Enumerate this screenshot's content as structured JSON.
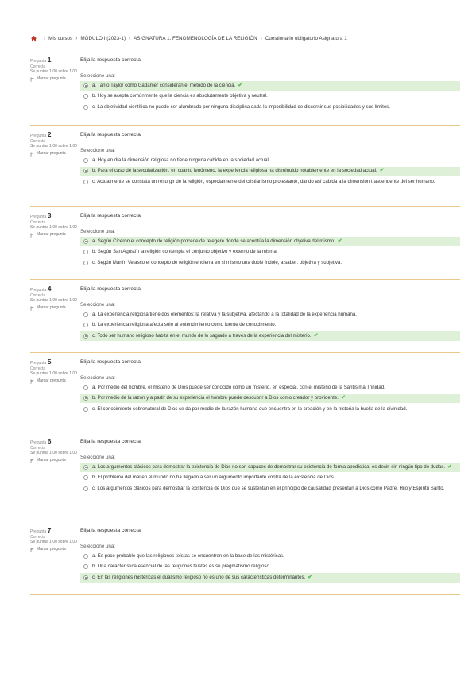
{
  "breadcrumb": [
    "Mis cursos",
    "MÓDULO I (2023-1)",
    "ASIGNATURA 1. FENOMENOLOGÍA DE LA RELIGIÓN",
    "Cuestionario obligatorio Asignatura 1"
  ],
  "labels": {
    "question": "Pregunta",
    "flag": "Marcar pregunta",
    "prompt": "Seleccione una:"
  },
  "questions": [
    {
      "number": "1",
      "state": "Correcta",
      "grade": "Se puntúa 1,00 sobre 1,00",
      "text": "Elija la respuesta correcta",
      "options": [
        {
          "text": "a. Tanto Taylor como Gadamer consideran el método de la ciencia.",
          "correct": true
        },
        {
          "text": "b. Hoy se acepta comúnmente que la ciencia es absolutamente objetiva y neutral.",
          "correct": false
        },
        {
          "text": "c. La objetividad científica no puede ser alumbrado por ninguna disciplina dada la imposibilidad de discernir sus posibilidades y sus límites.",
          "correct": false
        }
      ]
    },
    {
      "number": "2",
      "state": "Correcta",
      "grade": "Se puntúa 1,00 sobre 1,00",
      "text": "Elija la respuesta correcta",
      "options": [
        {
          "text": "a. Hoy en día la dimensión religiosa no tiene ninguna cabida en la sociedad actual.",
          "correct": false
        },
        {
          "text": "b. Para el caso de la secularización, en cuanto fenómeno, la experiencia religiosa ha disminuido notablemente en la sociedad actual.",
          "correct": true
        },
        {
          "text": "c. Actualmente se constata un resurgir de la religión, especialmente del cristianismo protestante, dando así cabida a la dimensión trascendente del ser humano.",
          "correct": false
        }
      ]
    },
    {
      "number": "3",
      "state": "Correcta",
      "grade": "Se puntúa 1,00 sobre 1,00",
      "text": "Elija la respuesta correcta",
      "options": [
        {
          "text": "a. Según Cicerón el concepto de religión procede de relegere donde se acentúa la dimensión objetiva del mismo.",
          "correct": true
        },
        {
          "text": "b. Según San Agustín la religión contempla el conjunto objetivo y externo de la misma.",
          "correct": false
        },
        {
          "text": "c. Según Martín Velasco el concepto de religión encierra en sí mismo una doble índole, a saber: objetiva y subjetiva.",
          "correct": false
        }
      ]
    },
    {
      "number": "4",
      "state": "Correcta",
      "grade": "Se puntúa 1,00 sobre 1,00",
      "text": "Elija la respuesta correcta",
      "options": [
        {
          "text": "a. La experiencia religiosa tiene dos elementos: la relativa y la subjetiva, afectando a la totalidad de la experiencia humana.",
          "correct": false
        },
        {
          "text": "b. La experiencia religiosa afecta solo al entendimiento como fuente de conocimiento.",
          "correct": false
        },
        {
          "text": "c. Todo ser humano religioso habita en el mundo de lo sagrado a través de la experiencia del misterio.",
          "correct": true
        }
      ]
    },
    {
      "number": "5",
      "state": "Correcta",
      "grade": "Se puntúa 1,00 sobre 1,00",
      "text": "Elija la respuesta correcta",
      "options": [
        {
          "text": "a. Por medio del hombre, el misterio de Dios puede ser conocido como un misterio, en especial, con el misterio de la Santísima Trinidad.",
          "correct": false
        },
        {
          "text": "b. Por medio de la razón y a partir de su experiencia el hombre puede descubrir a Dios como creador y providente.",
          "correct": true
        },
        {
          "text": "c. El conocimiento sobrenatural de Dios se da por medio de la razón humana que encuentra en la creación y en la historia la huella de la divinidad.",
          "correct": false
        }
      ]
    },
    {
      "number": "6",
      "state": "Correcta",
      "grade": "Se puntúa 1,00 sobre 1,00",
      "text": "Elija la respuesta correcta",
      "options": [
        {
          "text": "a. Los argumentos clásicos para demostrar la existencia de Dios no son capaces de demostrar su existencia de forma apodíctica, es decir, sin ningún tipo de dudas.",
          "correct": true
        },
        {
          "text": "b. El problema del mal en el mundo no ha llegado a ser un argumento importante contra de la existencia de Dios.",
          "correct": false
        },
        {
          "text": "c. Los argumentos clásicos para demostrar la existencia de Dios que se sustentan en el principio de causalidad presentan a Dios como Padre, Hijo y Espíritu Santo.",
          "correct": false
        }
      ]
    },
    {
      "number": "7",
      "state": "Correcta",
      "grade": "Se puntúa 1,00 sobre 1,00",
      "text": "Elija la respuesta correcta",
      "options": [
        {
          "text": "a. Es poco probable que las religiones teístas se encuentren en la base de las mistéricas.",
          "correct": false
        },
        {
          "text": "b. Una característica esencial de las religiones teístas es su pragmatismo religioso.",
          "correct": false
        },
        {
          "text": "c. En las religiones mistéricas el dualismo religioso no es uno de sus características determinantes.",
          "correct": true
        }
      ]
    }
  ]
}
